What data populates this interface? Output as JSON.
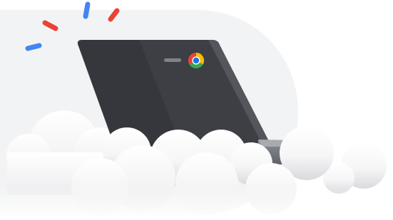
{
  "illustration": {
    "subject": "chromebook-laptop-on-clouds",
    "icons": [
      "chrome-logo-icon"
    ],
    "colors": {
      "backdrop": "#f2f3f4",
      "laptop_lid": "#35373c",
      "laptop_lid_light": "#3e4045",
      "laptop_edge": "#53565c",
      "laptop_base": "#9aa0a6",
      "cloud": "#ffffff",
      "cloud_shade": "#dadce0",
      "chrome_red": "#ea4335",
      "chrome_yellow": "#fbbc04",
      "chrome_green": "#34a853",
      "chrome_blue": "#1a73e8",
      "accent_red": "#ea4335",
      "accent_blue": "#4285f4"
    }
  }
}
